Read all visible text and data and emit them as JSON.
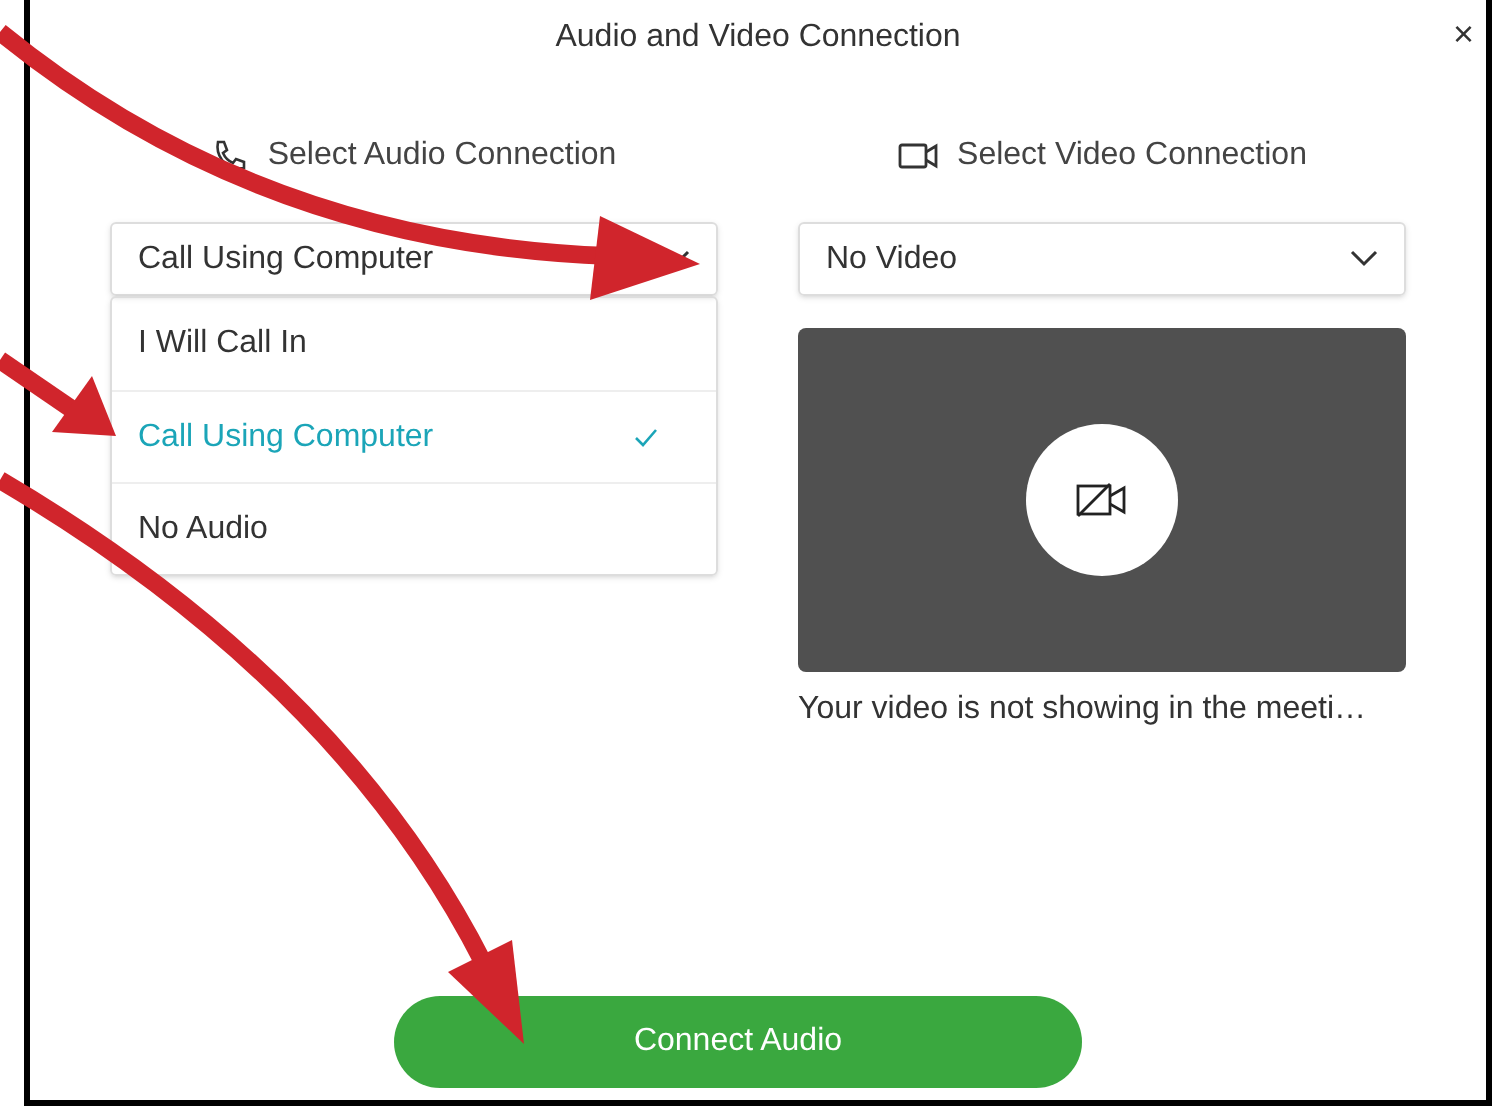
{
  "window": {
    "title": "Audio and Video Connection",
    "close": "×"
  },
  "audio": {
    "heading": "Select Audio Connection",
    "value": "Call Using Computer",
    "expanded": true,
    "options": [
      {
        "label": "I Will Call In",
        "selected": false
      },
      {
        "label": "Call Using Computer",
        "selected": true
      },
      {
        "label": "No Audio",
        "selected": false
      }
    ]
  },
  "video": {
    "heading": "Select Video Connection",
    "value": "No Video",
    "caption": "Your video is not showing in the meeti…"
  },
  "primary_button": "Connect Audio"
}
